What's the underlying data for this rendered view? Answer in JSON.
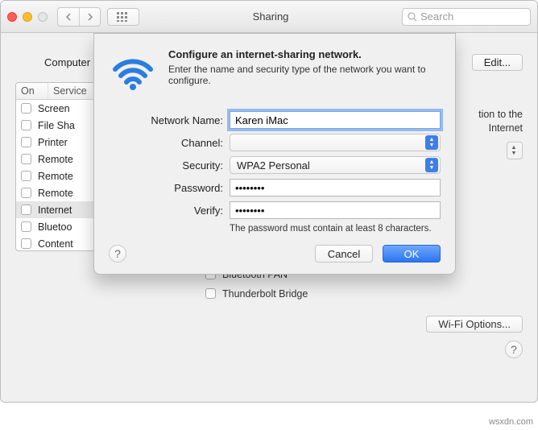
{
  "window": {
    "title": "Sharing",
    "search_placeholder": "Search"
  },
  "header": {
    "computer_label": "Computer",
    "edit_label": "Edit..."
  },
  "services": {
    "col_on": "On",
    "col_service": "Service",
    "items": [
      {
        "label": "Screen",
        "on": false,
        "selected": false
      },
      {
        "label": "File Sha",
        "on": false,
        "selected": false
      },
      {
        "label": "Printer",
        "on": false,
        "selected": false
      },
      {
        "label": "Remote",
        "on": false,
        "selected": false
      },
      {
        "label": "Remote",
        "on": false,
        "selected": false
      },
      {
        "label": "Remote",
        "on": false,
        "selected": false
      },
      {
        "label": "Internet",
        "on": false,
        "selected": true
      },
      {
        "label": "Bluetoo",
        "on": false,
        "selected": false
      },
      {
        "label": "Content",
        "on": false,
        "selected": false
      }
    ]
  },
  "right_panel": {
    "desc_tail_1": "tion to the",
    "desc_tail_2": "Internet",
    "ports": [
      {
        "label": "Bluetooth PAN",
        "on": false
      },
      {
        "label": "Thunderbolt Bridge",
        "on": false
      }
    ],
    "wifi_options_label": "Wi-Fi Options..."
  },
  "sheet": {
    "title": "Configure an internet-sharing network.",
    "subtitle": "Enter the name and security type of the network you want to configure.",
    "labels": {
      "network_name": "Network Name:",
      "channel": "Channel:",
      "security": "Security:",
      "password": "Password:",
      "verify": "Verify:"
    },
    "values": {
      "network_name": "Karen iMac",
      "channel": "",
      "security": "WPA2 Personal",
      "password": "••••••••",
      "verify": "••••••••"
    },
    "hint": "The password must contain at least 8 characters.",
    "cancel_label": "Cancel",
    "ok_label": "OK"
  },
  "watermark": "wsxdn.com"
}
